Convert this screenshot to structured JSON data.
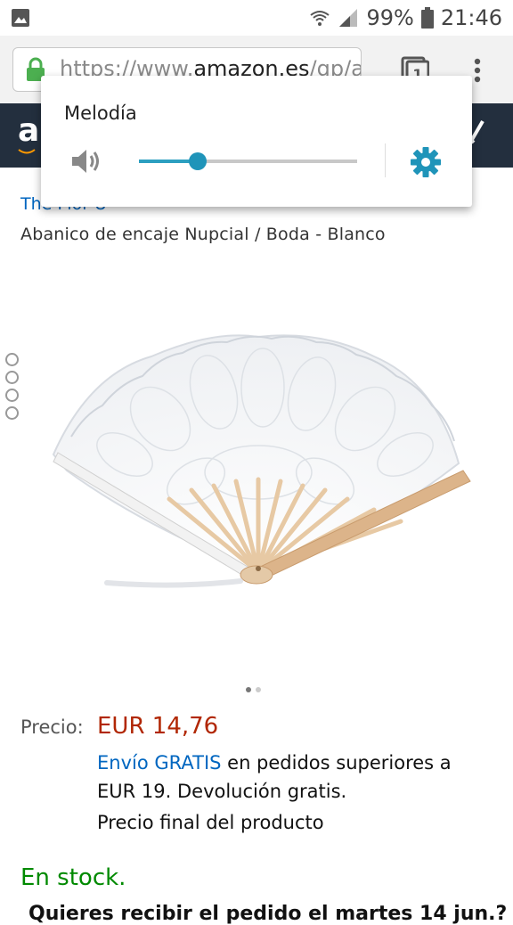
{
  "status_bar": {
    "battery": "99%",
    "time": "21:46"
  },
  "browser": {
    "url_prefix": "https://www.",
    "url_domain": "amazon.es",
    "url_rest": "/gp/aw/",
    "tab_count": "1"
  },
  "volume_popup": {
    "title": "Melodía",
    "level": 0.27
  },
  "product": {
    "brand": "The Flor U",
    "title": "Abanico de encaje Nupcial / Boda - Blanco",
    "price_label": "Precio:",
    "price": "EUR 14,76",
    "shipping_link": "Envío GRATIS",
    "shipping_text": " en pedidos superiores a EUR 19. Devolución gratis.",
    "final_price_note": "Precio final del producto",
    "stock": "En stock.",
    "cutoff_text": "Quieres recibir el pedido el martes 14 jun.?",
    "image_count": 2,
    "image_index": 1
  },
  "colors": {
    "amazon_header": "#232f3e",
    "price": "#b12704",
    "link": "#0066c0",
    "stock": "#008a00",
    "volume_accent": "#1f94b9"
  }
}
